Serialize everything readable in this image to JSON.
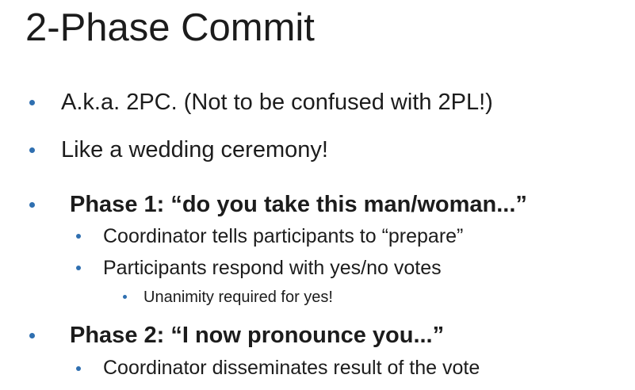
{
  "slide": {
    "title": "2-Phase Commit",
    "bullets": [
      "A.k.a. 2PC.  (Not to be confused with 2PL!)",
      "Like a wedding ceremony!",
      "Phase 1: “do you take this man/woman...”",
      "Coordinator tells participants to “prepare”",
      "Participants respond with yes/no votes",
      "Unanimity required for yes!",
      "Phase 2: “I now pronounce you...”",
      "Coordinator disseminates result of the vote"
    ]
  },
  "colors": {
    "bullet": "#2f6fb0",
    "text": "#1c1c1c",
    "background": "#ffffff"
  }
}
